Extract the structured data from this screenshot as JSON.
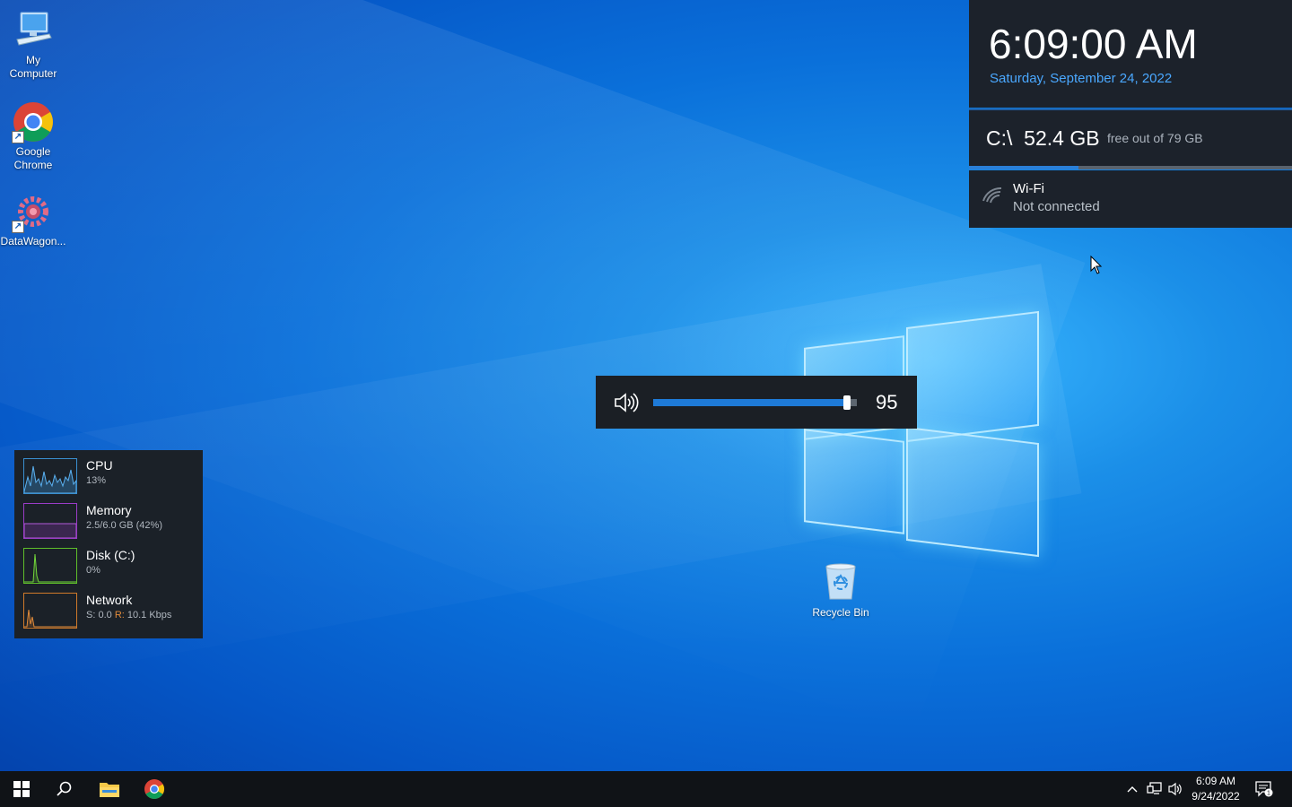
{
  "desktop": {
    "icons": [
      {
        "label_line1": "My",
        "label_line2": "Computer"
      },
      {
        "label_line1": "Google",
        "label_line2": "Chrome"
      },
      {
        "label_line1": "DataWagon...",
        "label_line2": ""
      }
    ],
    "recycle_bin_label": "Recycle Bin"
  },
  "clock_widget": {
    "time": "6:09:00 AM",
    "date": "Saturday, September 24, 2022"
  },
  "disk_widget": {
    "drive": "C:\\",
    "free": "52.4 GB",
    "subtitle": "free out of 79 GB",
    "used_fraction": 0.34
  },
  "wifi_widget": {
    "name": "Wi-Fi",
    "status": "Not connected"
  },
  "volume_osd": {
    "level": 95
  },
  "performance": {
    "rows": [
      {
        "title": "CPU",
        "sub": "13%",
        "color": "#3a8fd0"
      },
      {
        "title": "Memory",
        "sub": "2.5/6.0 GB (42%)",
        "color": "#9b3cc8"
      },
      {
        "title": "Disk (C:)",
        "sub": "0%",
        "color": "#5fbf2a"
      },
      {
        "title": "Network",
        "sub_send": "S: 0.0",
        "sub_recv_label": "R:",
        "sub_recv": "10.1 Kbps",
        "color": "#d07a2a"
      }
    ]
  },
  "taskbar": {
    "time": "6:09 AM",
    "date": "9/24/2022",
    "notification_count": "1"
  }
}
